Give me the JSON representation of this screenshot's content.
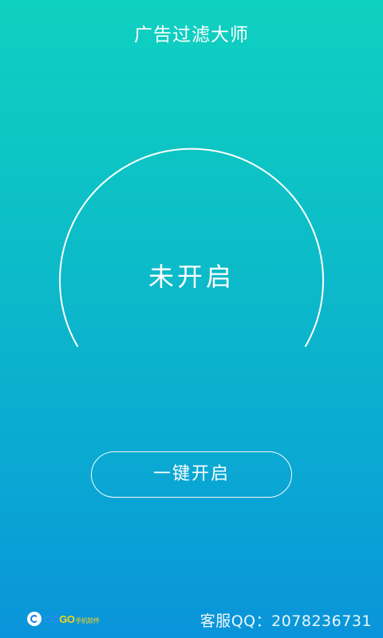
{
  "header": {
    "title": "广告过滤大师"
  },
  "status": {
    "label": "未开启"
  },
  "actions": {
    "enable_label": "一键开启"
  },
  "footer": {
    "logo_part1": "GO",
    "logo_part2": "GO",
    "logo_sub": "手机软件",
    "support_text": "客服QQ：2078236731"
  },
  "colors": {
    "gradient_top": "#0fd1c0",
    "gradient_bottom": "#0a94da",
    "foreground": "#ffffff"
  }
}
